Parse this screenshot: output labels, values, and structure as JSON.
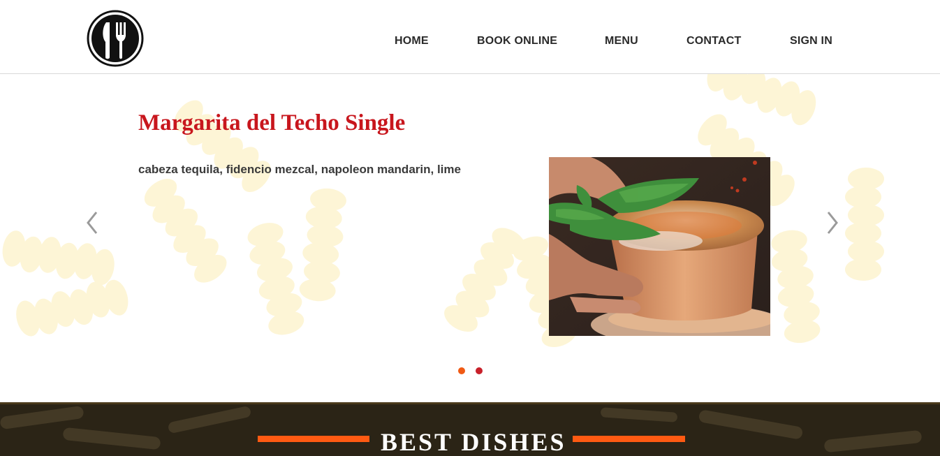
{
  "header": {
    "logo_icon": "fork-knife-icon",
    "nav": [
      {
        "label": "HOME"
      },
      {
        "label": "BOOK ONLINE"
      },
      {
        "label": "MENU"
      },
      {
        "label": "CONTACT"
      },
      {
        "label": "SIGN IN"
      }
    ]
  },
  "slider": {
    "title": "Margarita del Techo Single",
    "description": "cabeza tequila, fidencio mezcal, napoleon mandarin, lime",
    "prev_icon": "chevron-left-icon",
    "next_icon": "chevron-right-icon",
    "slide_count": 2,
    "active_index": 0
  },
  "section": {
    "title": "BEST DISHES"
  },
  "colors": {
    "title_red": "#c8161d",
    "accent_orange": "#ff5a12",
    "dark_band": "#2b2416"
  }
}
